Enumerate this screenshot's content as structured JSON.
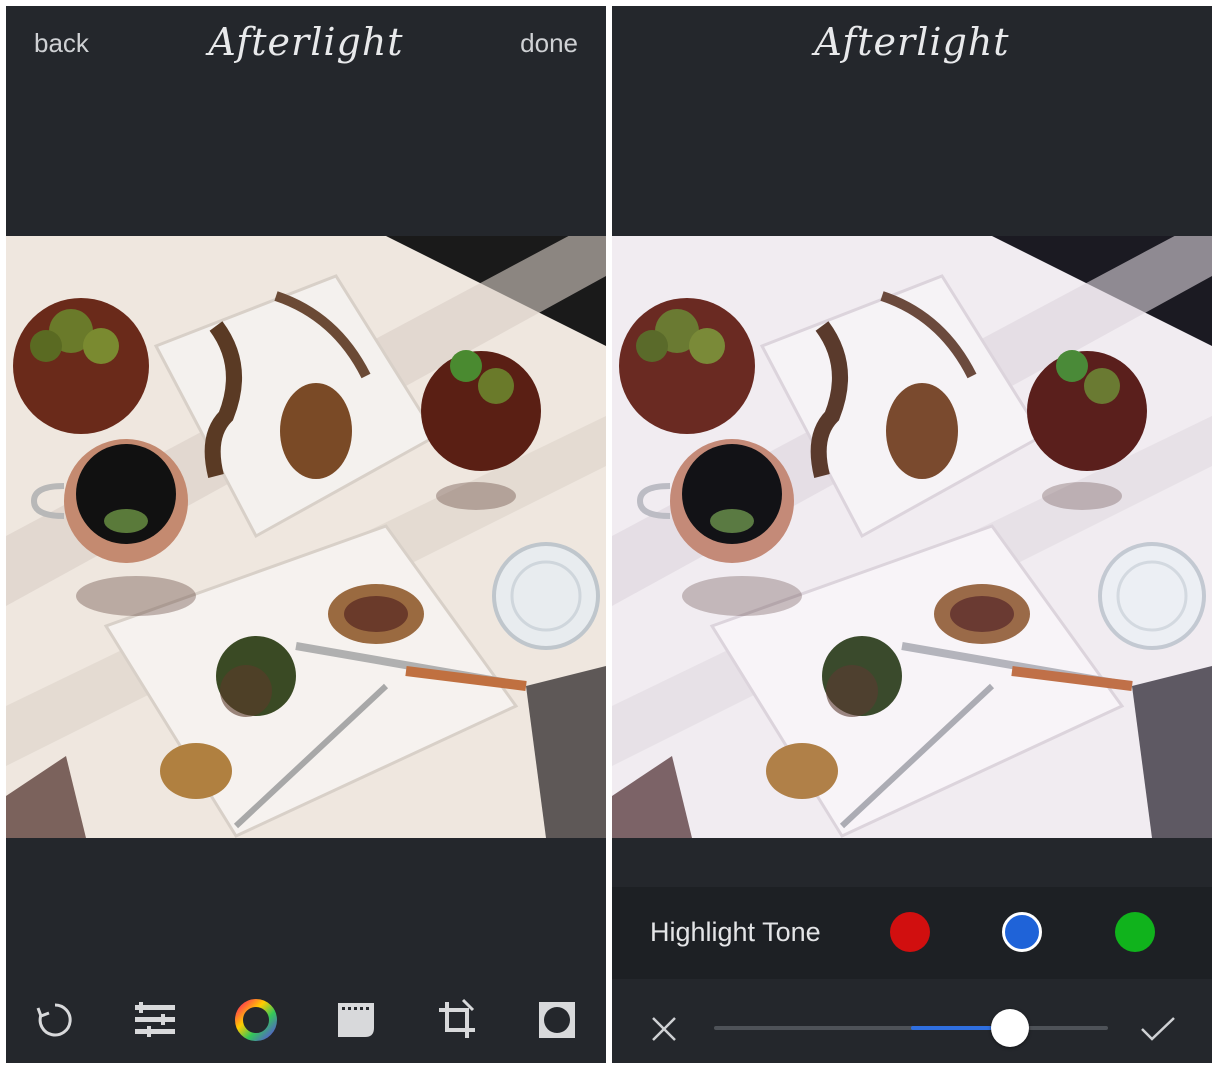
{
  "left_screen": {
    "header": {
      "back_label": "back",
      "logo_text": "Afterlight",
      "done_label": "done"
    },
    "toolbar": {
      "items": [
        {
          "icon": "rotate-reset-icon"
        },
        {
          "icon": "adjust-sliders-icon"
        },
        {
          "icon": "color-filter-ring-icon"
        },
        {
          "icon": "film-frame-icon"
        },
        {
          "icon": "crop-icon"
        },
        {
          "icon": "frame-border-icon"
        }
      ]
    }
  },
  "right_screen": {
    "header": {
      "logo_text": "Afterlight"
    },
    "tone_panel": {
      "label": "Highlight Tone",
      "swatches": [
        {
          "name": "red",
          "color": "#d10f0f",
          "selected": false
        },
        {
          "name": "blue",
          "color": "#1f63d8",
          "selected": true
        },
        {
          "name": "green",
          "color": "#10b31c",
          "selected": false
        }
      ]
    },
    "slider": {
      "value": 0.75,
      "cancel_icon": "close-icon",
      "confirm_icon": "checkmark-icon"
    }
  },
  "colors": {
    "background": "#24272c",
    "accent": "#2f6fe0"
  }
}
